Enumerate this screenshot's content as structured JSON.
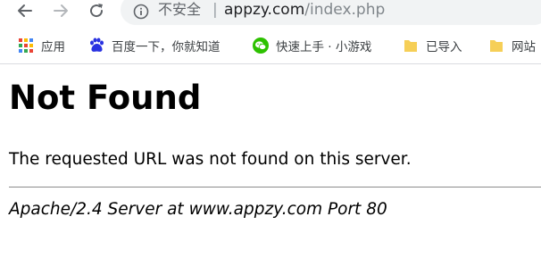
{
  "browser": {
    "nav": {
      "back_icon": "arrow-left-icon",
      "forward_icon": "arrow-right-icon",
      "reload_icon": "reload-icon"
    },
    "omnibox": {
      "security_icon": "info-icon",
      "security_label": "不安全",
      "separator": "|",
      "url_host": "appzy.com",
      "url_path": "/index.php"
    },
    "bookmarks": [
      {
        "label": "应用",
        "icon": "apps-grid-icon"
      },
      {
        "label": "百度一下，你就知道",
        "icon": "baidu-paw-icon"
      },
      {
        "label": "快速上手 · 小游戏",
        "icon": "wechat-icon"
      },
      {
        "label": "已导入",
        "icon": "folder-icon"
      },
      {
        "label": "网站",
        "icon": "folder-icon"
      }
    ]
  },
  "page": {
    "heading": "Not Found",
    "message": "The requested URL was not found on this server.",
    "server_signature": "Apache/2.4 Server at www.appzy.com Port 80"
  },
  "colors": {
    "chrome_bg": "#ffffff",
    "omnibox_bg": "#f1f3f4",
    "folder_yellow": "#f6cf57",
    "wechat_green": "#2dc100",
    "baidu_blue": "#2932e1"
  }
}
